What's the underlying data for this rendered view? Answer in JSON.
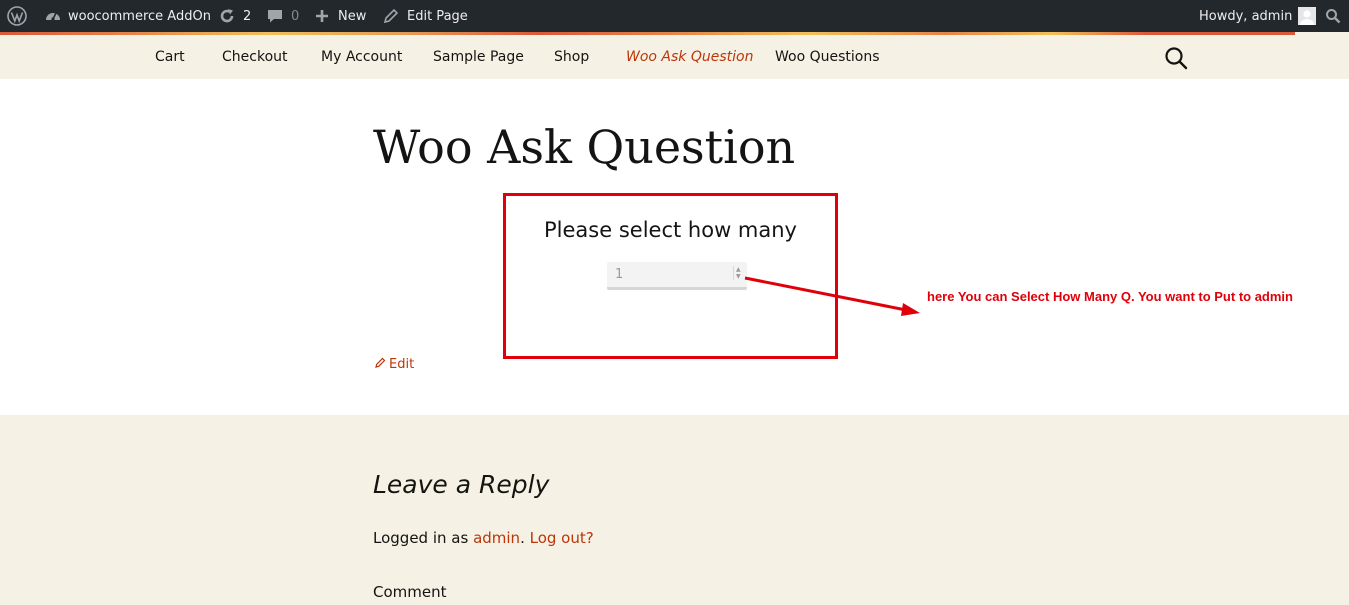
{
  "adminbar": {
    "site_name": "woocommerce AddOn",
    "updates_count": "2",
    "comments_count": "0",
    "new_label": "New",
    "edit_page_label": "Edit Page",
    "howdy": "Howdy, admin"
  },
  "nav": {
    "items": [
      {
        "label": "Cart"
      },
      {
        "label": "Checkout"
      },
      {
        "label": "My Account"
      },
      {
        "label": "Sample Page"
      },
      {
        "label": "Shop"
      },
      {
        "label": "Woo Ask Question"
      },
      {
        "label": "Woo Questions"
      }
    ],
    "current": "Woo Ask Question"
  },
  "page": {
    "title": "Woo Ask Question",
    "select_label": "Please select how many",
    "quantity_value": "1",
    "edit_label": "Edit"
  },
  "annotation": {
    "text": "here You can Select How Many Q. You want to Put to admin",
    "color": "#e0000a"
  },
  "comments": {
    "reply_title": "Leave a Reply",
    "logged_in_prefix": "Logged in as",
    "user_link": "admin",
    "separator": ".",
    "logout_link": "Log out?",
    "comment_label": "Comment"
  },
  "colors": {
    "admin_bar_bg": "#23282d",
    "nav_bg": "#f5f1e4",
    "accent": "#bc360a",
    "annotation_red": "#e0000a"
  }
}
